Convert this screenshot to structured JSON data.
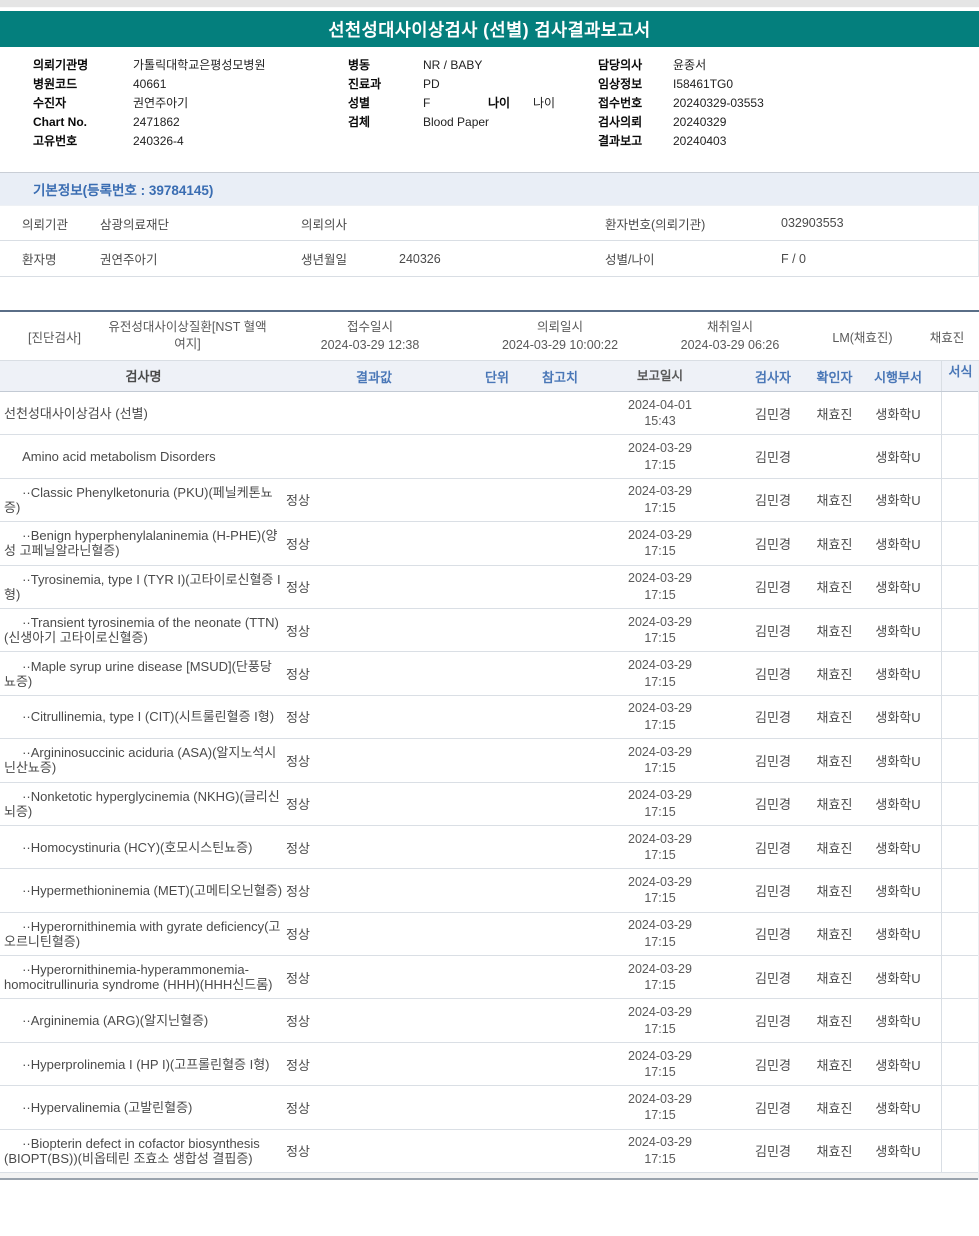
{
  "title": "선천성대사이상검사 (선별) 검사결과보고서",
  "colors": {
    "title_bar_teal": "#047f7d",
    "section_blue_text": "#3a6db2",
    "table_header_blue_text": "#4a77b7",
    "dark_divider": "#5a6e87"
  },
  "patient_header": {
    "col1": [
      {
        "label": "의뢰기관명",
        "value": "가톨릭대학교은평성모병원"
      },
      {
        "label": "병원코드",
        "value": "40661"
      },
      {
        "label": "수진자",
        "value": "권연주아기"
      },
      {
        "label": "Chart No.",
        "value": "2471862"
      },
      {
        "label": "고유번호",
        "value": "240326-4"
      }
    ],
    "col2": [
      {
        "label": "병동",
        "value": "NR / BABY"
      },
      {
        "label": "진료과",
        "value": "PD"
      },
      {
        "label": "성별",
        "value": "F",
        "label2": "나이",
        "value2": "나이"
      },
      {
        "label": "검체",
        "value": "Blood Paper"
      }
    ],
    "col3": [
      {
        "label": "담당의사",
        "value": "윤종서"
      },
      {
        "label": "임상정보",
        "value": "I58461TG0"
      },
      {
        "label": "접수번호",
        "value": "20240329-03553"
      },
      {
        "label": "검사의뢰",
        "value": "20240329"
      },
      {
        "label": "결과보고",
        "value": "20240403"
      }
    ]
  },
  "basic_info": {
    "section_title": "기본정보(등록번호 : 39784145)",
    "rows": [
      {
        "l1": "의뢰기관",
        "v1": "삼광의료재단",
        "l2": "의뢰의사",
        "v2": "",
        "l3": "환자번호(의뢰기관)",
        "v3": "032903553"
      },
      {
        "l1": "환자명",
        "v1": "권연주아기",
        "l2": "생년월일",
        "v2": "240326",
        "l3": "성별/나이",
        "v3": "F / 0"
      }
    ]
  },
  "diagnosis": {
    "tag": "[진단검사]",
    "test_group": "유전성대사이상질환[NST 혈액여지]",
    "receipt_label": "접수일시",
    "receipt_datetime": "2024-03-29 12:38",
    "request_label": "의뢰일시",
    "request_datetime": "2024-03-29 10:00:22",
    "collect_label": "채취일시",
    "collect_datetime": "2024-03-29 06:26",
    "collector": "LM(채효진)",
    "collector2": "채효진"
  },
  "results": {
    "columns": [
      "검사명",
      "결과값",
      "단위",
      "참고치",
      "보고일시",
      "검사자",
      "확인자",
      "시행부서",
      "서식"
    ],
    "rows": [
      {
        "name": "선천성대사이상검사 (선별)",
        "result": "",
        "reported": "2024-04-01 15:43",
        "tester": "김민경",
        "verifier": "채효진",
        "dept": "생화학U"
      },
      {
        "name": "     Amino acid metabolism Disorders",
        "result": "",
        "reported": "2024-03-29 17:15",
        "tester": "김민경",
        "verifier": "",
        "dept": "생화학U"
      },
      {
        "name": "     ··Classic Phenylketonuria (PKU)(페닐케톤뇨증)",
        "result": "정상",
        "reported": "2024-03-29 17:15",
        "tester": "김민경",
        "verifier": "채효진",
        "dept": "생화학U"
      },
      {
        "name": "     ··Benign hyperphenylalaninemia (H-PHE)(양성 고페닐알라닌혈증)",
        "result": "정상",
        "reported": "2024-03-29 17:15",
        "tester": "김민경",
        "verifier": "채효진",
        "dept": "생화학U"
      },
      {
        "name": "     ··Tyrosinemia, type I (TYR I)(고타이로신혈증 I형)",
        "result": "정상",
        "reported": "2024-03-29 17:15",
        "tester": "김민경",
        "verifier": "채효진",
        "dept": "생화학U"
      },
      {
        "name": "     ··Transient tyrosinemia of the neonate (TTN)(신생아기 고타이로신혈증)",
        "result": "정상",
        "reported": "2024-03-29 17:15",
        "tester": "김민경",
        "verifier": "채효진",
        "dept": "생화학U"
      },
      {
        "name": "     ··Maple syrup urine disease [MSUD](단풍당뇨증)",
        "result": "정상",
        "reported": "2024-03-29 17:15",
        "tester": "김민경",
        "verifier": "채효진",
        "dept": "생화학U"
      },
      {
        "name": "     ··Citrullinemia, type I (CIT)(시트룰린혈증 I형)",
        "result": "정상",
        "reported": "2024-03-29 17:15",
        "tester": "김민경",
        "verifier": "채효진",
        "dept": "생화학U"
      },
      {
        "name": "     ··Argininosuccinic aciduria (ASA)(알지노석시닌산뇨증)",
        "result": "정상",
        "reported": "2024-03-29 17:15",
        "tester": "김민경",
        "verifier": "채효진",
        "dept": "생화학U"
      },
      {
        "name": "     ··Nonketotic hyperglycinemia (NKHG)(글리신뇌증)",
        "result": "정상",
        "reported": "2024-03-29 17:15",
        "tester": "김민경",
        "verifier": "채효진",
        "dept": "생화학U"
      },
      {
        "name": "     ··Homocystinuria (HCY)(호모시스틴뇨증)",
        "result": "정상",
        "reported": "2024-03-29 17:15",
        "tester": "김민경",
        "verifier": "채효진",
        "dept": "생화학U"
      },
      {
        "name": "     ··Hypermethioninemia (MET)(고메티오닌혈증)",
        "result": "정상",
        "reported": "2024-03-29 17:15",
        "tester": "김민경",
        "verifier": "채효진",
        "dept": "생화학U"
      },
      {
        "name": "     ··Hyperornithinemia with gyrate deficiency(고오르니틴혈증)",
        "result": "정상",
        "reported": "2024-03-29 17:15",
        "tester": "김민경",
        "verifier": "채효진",
        "dept": "생화학U"
      },
      {
        "name": "     ··Hyperornithinemia-hyperammonemia-homocitrullinuria syndrome (HHH)(HHH신드롬)",
        "result": "정상",
        "reported": "2024-03-29 17:15",
        "tester": "김민경",
        "verifier": "채효진",
        "dept": "생화학U"
      },
      {
        "name": "     ··Argininemia (ARG)(알지닌혈증)",
        "result": "정상",
        "reported": "2024-03-29 17:15",
        "tester": "김민경",
        "verifier": "채효진",
        "dept": "생화학U"
      },
      {
        "name": "     ··Hyperprolinemia I (HP I)(고프롤린혈증 I형)",
        "result": "정상",
        "reported": "2024-03-29 17:15",
        "tester": "김민경",
        "verifier": "채효진",
        "dept": "생화학U"
      },
      {
        "name": "     ··Hypervalinemia (고발린혈증)",
        "result": "정상",
        "reported": "2024-03-29 17:15",
        "tester": "김민경",
        "verifier": "채효진",
        "dept": "생화학U"
      },
      {
        "name": "     ··Biopterin defect in cofactor biosynthesis (BIOPT(BS))(비옵테린 조효소 생합성 결핍증)",
        "result": "정상",
        "reported": "2024-03-29 17:15",
        "tester": "김민경",
        "verifier": "채효진",
        "dept": "생화학U"
      }
    ]
  }
}
